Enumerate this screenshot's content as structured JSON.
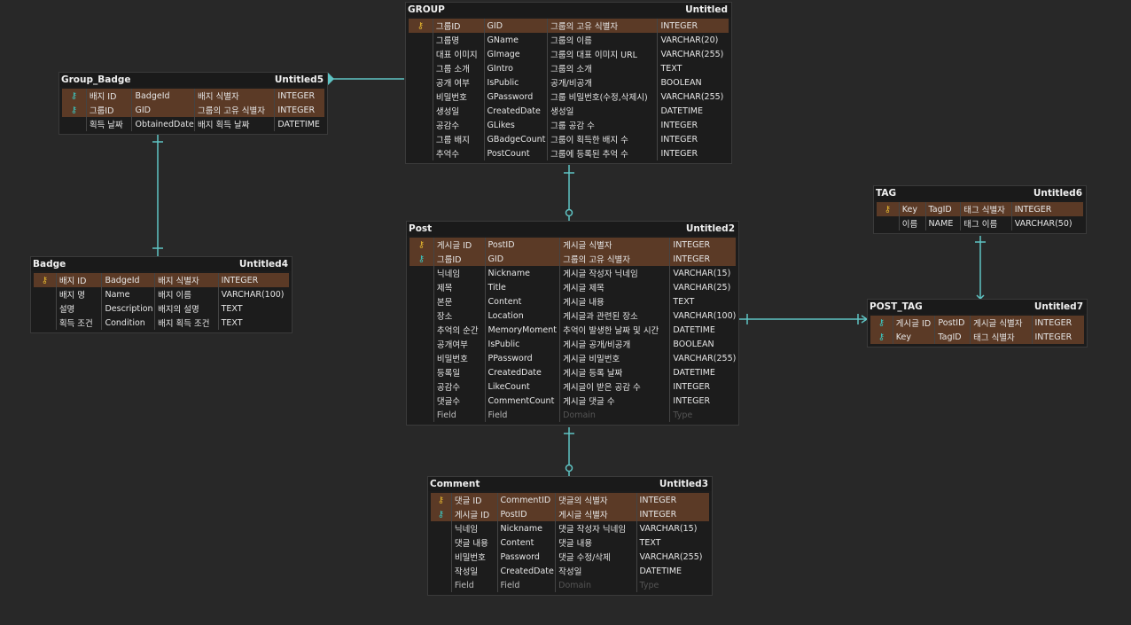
{
  "tables": {
    "group": {
      "name": "GROUP",
      "tag": "Untitled",
      "rows": [
        {
          "key": "pk",
          "label": "그룹ID",
          "field": "GID",
          "desc": "그룹의 고유 식별자",
          "type": "INTEGER"
        },
        {
          "key": "",
          "label": "그룹명",
          "field": "GName",
          "desc": "그룹의 이름",
          "type": "VARCHAR(20)"
        },
        {
          "key": "",
          "label": "대표 이미지",
          "field": "GImage",
          "desc": "그룹의 대표 이미지 URL",
          "type": "VARCHAR(255)"
        },
        {
          "key": "",
          "label": "그룹 소개",
          "field": "GIntro",
          "desc": "그룹의 소개",
          "type": "TEXT"
        },
        {
          "key": "",
          "label": "공개 여부",
          "field": "IsPublic",
          "desc": "공개/비공개",
          "type": "BOOLEAN"
        },
        {
          "key": "",
          "label": "비밀번호",
          "field": "GPassword",
          "desc": "그룹 비밀번호(수정,삭제시)",
          "type": "VARCHAR(255)"
        },
        {
          "key": "",
          "label": "생성일",
          "field": "CreatedDate",
          "desc": "생성일",
          "type": "DATETIME"
        },
        {
          "key": "",
          "label": "공감수",
          "field": "GLikes",
          "desc": "그룹 공감 수",
          "type": "INTEGER"
        },
        {
          "key": "",
          "label": "그룹 배지",
          "field": "GBadgeCount",
          "desc": "그룹이 획득한 배지 수",
          "type": "INTEGER"
        },
        {
          "key": "",
          "label": "추억수",
          "field": "PostCount",
          "desc": "그룹에 등록된 추억 수",
          "type": "INTEGER"
        }
      ]
    },
    "group_badge": {
      "name": "Group_Badge",
      "tag": "Untitled5",
      "rows": [
        {
          "key": "fk",
          "label": "배지 ID",
          "field": "BadgeId",
          "desc": "배지 식별자",
          "type": "INTEGER"
        },
        {
          "key": "fk",
          "label": "그룹ID",
          "field": "GID",
          "desc": "그룹의 고유 식별자",
          "type": "INTEGER"
        },
        {
          "key": "",
          "label": "획득 날짜",
          "field": "ObtainedDate",
          "desc": "배지 획득 날짜",
          "type": "DATETIME"
        }
      ]
    },
    "badge": {
      "name": "Badge",
      "tag": "Untitled4",
      "rows": [
        {
          "key": "pk",
          "label": "배지 ID",
          "field": "BadgeId",
          "desc": "배지 식별자",
          "type": "INTEGER"
        },
        {
          "key": "",
          "label": "배지 명",
          "field": "Name",
          "desc": "배지 이름",
          "type": "VARCHAR(100)"
        },
        {
          "key": "",
          "label": "설명",
          "field": "Description",
          "desc": "배지의 설명",
          "type": "TEXT"
        },
        {
          "key": "",
          "label": "획득 조건",
          "field": "Condition",
          "desc": "배지 획득 조건",
          "type": "TEXT"
        }
      ]
    },
    "post": {
      "name": "Post",
      "tag": "Untitled2",
      "rows": [
        {
          "key": "pk",
          "label": "게시글 ID",
          "field": "PostID",
          "desc": "게시글 식별자",
          "type": "INTEGER"
        },
        {
          "key": "fk",
          "label": "그룹ID",
          "field": "GID",
          "desc": "그룹의 고유 식별자",
          "type": "INTEGER"
        },
        {
          "key": "",
          "label": "닉네임",
          "field": "Nickname",
          "desc": "게시글 작성자 닉네임",
          "type": "VARCHAR(15)"
        },
        {
          "key": "",
          "label": "제목",
          "field": "Title",
          "desc": "게시글 제목",
          "type": "VARCHAR(25)"
        },
        {
          "key": "",
          "label": "본문",
          "field": "Content",
          "desc": "게시글 내용",
          "type": "TEXT"
        },
        {
          "key": "",
          "label": "장소",
          "field": "Location",
          "desc": "게시글과 관련된 장소",
          "type": "VARCHAR(100)"
        },
        {
          "key": "",
          "label": "추억의 순간",
          "field": "MemoryMoment",
          "desc": "추억이 발생한 날짜 및 시간",
          "type": "DATETIME"
        },
        {
          "key": "",
          "label": "공개여부",
          "field": "IsPublic",
          "desc": "게시글 공개/비공개",
          "type": "BOOLEAN"
        },
        {
          "key": "",
          "label": "비밀번호",
          "field": "PPassword",
          "desc": "게시글 비밀번호",
          "type": "VARCHAR(255)"
        },
        {
          "key": "",
          "label": "등록일",
          "field": "CreatedDate",
          "desc": "게시글 등록 날짜",
          "type": "DATETIME"
        },
        {
          "key": "",
          "label": "공감수",
          "field": "LikeCount",
          "desc": "게시글이 받은 공감 수",
          "type": "INTEGER"
        },
        {
          "key": "",
          "label": "댓글수",
          "field": "CommentCount",
          "desc": "게시글 댓글 수",
          "type": "INTEGER"
        },
        {
          "key": "",
          "label": "Field",
          "field": "Field",
          "desc": "Domain",
          "type": "Type",
          "placeholder": true
        }
      ]
    },
    "comment": {
      "name": "Comment",
      "tag": "Untitled3",
      "rows": [
        {
          "key": "pk",
          "label": "댓글 ID",
          "field": "CommentID",
          "desc": "댓글의 식별자",
          "type": "INTEGER"
        },
        {
          "key": "fk",
          "label": "게시글 ID",
          "field": "PostID",
          "desc": "게시글 식별자",
          "type": "INTEGER"
        },
        {
          "key": "",
          "label": "닉네임",
          "field": "Nickname",
          "desc": "댓글 작성자 닉네임",
          "type": "VARCHAR(15)"
        },
        {
          "key": "",
          "label": "댓글 내용",
          "field": "Content",
          "desc": "댓글 내용",
          "type": "TEXT"
        },
        {
          "key": "",
          "label": "비밀번호",
          "field": "Password",
          "desc": "댓글 수정/삭제",
          "type": "VARCHAR(255)"
        },
        {
          "key": "",
          "label": "작성일",
          "field": "CreatedDate",
          "desc": "작성일",
          "type": "DATETIME"
        },
        {
          "key": "",
          "label": "Field",
          "field": "Field",
          "desc": "Domain",
          "type": "Type",
          "placeholder": true
        }
      ]
    },
    "tag": {
      "name": "TAG",
      "tag": "Untitled6",
      "rows": [
        {
          "key": "pk",
          "label": "Key",
          "field": "TagID",
          "desc": "태그 식별자",
          "type": "INTEGER"
        },
        {
          "key": "",
          "label": "이름",
          "field": "NAME",
          "desc": "태그 이름",
          "type": "VARCHAR(50)"
        }
      ]
    },
    "post_tag": {
      "name": "POST_TAG",
      "tag": "Untitled7",
      "rows": [
        {
          "key": "fk",
          "label": "게시글 ID",
          "field": "PostID",
          "desc": "게시글 식별자",
          "type": "INTEGER"
        },
        {
          "key": "fk",
          "label": "Key",
          "field": "TagID",
          "desc": "태그 식별자",
          "type": "INTEGER"
        }
      ]
    }
  },
  "colors": {
    "background": "#282828",
    "table_bg": "#1c1c1c",
    "pk_row": "#5b3a26",
    "connector": "#5fc4c4",
    "pk_key_icon": "#e0b22e",
    "fk_key_icon": "#3cc6c0"
  },
  "icons": {
    "pk": "key-icon",
    "fk": "foreign-key-icon"
  }
}
